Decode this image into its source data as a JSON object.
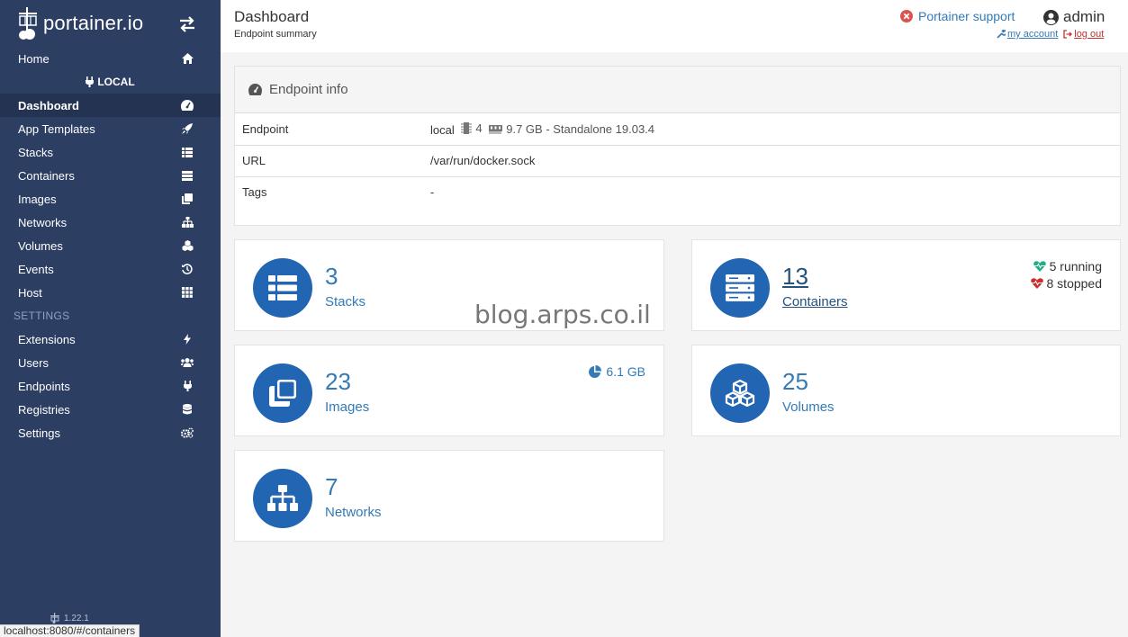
{
  "brand": {
    "name": "portainer.io"
  },
  "sidebar": {
    "items_top": [
      {
        "label": "Home",
        "icon": "home-icon"
      }
    ],
    "endpoint_header": "LOCAL",
    "items": [
      {
        "label": "Dashboard",
        "icon": "dashboard-icon",
        "active": true
      },
      {
        "label": "App Templates",
        "icon": "rocket-icon"
      },
      {
        "label": "Stacks",
        "icon": "list-icon"
      },
      {
        "label": "Containers",
        "icon": "server-icon"
      },
      {
        "label": "Images",
        "icon": "clone-icon"
      },
      {
        "label": "Networks",
        "icon": "sitemap-icon"
      },
      {
        "label": "Volumes",
        "icon": "cubes-icon"
      },
      {
        "label": "Events",
        "icon": "history-icon"
      },
      {
        "label": "Host",
        "icon": "th-icon"
      }
    ],
    "settings_title": "SETTINGS",
    "settings_items": [
      {
        "label": "Extensions",
        "icon": "bolt-icon"
      },
      {
        "label": "Users",
        "icon": "users-icon"
      },
      {
        "label": "Endpoints",
        "icon": "plug-icon"
      },
      {
        "label": "Registries",
        "icon": "database-icon"
      },
      {
        "label": "Settings",
        "icon": "cogs-icon"
      }
    ],
    "version": "1.22.1"
  },
  "status_bar": {
    "url": "localhost:8080/#/containers"
  },
  "header": {
    "title": "Dashboard",
    "subtitle": "Endpoint summary",
    "support_label": "Portainer support",
    "username": "admin",
    "my_account": "my account",
    "logout": "log out"
  },
  "endpoint_info": {
    "title": "Endpoint info",
    "rows": [
      {
        "key": "Endpoint",
        "value": "local",
        "cpus": "4",
        "memory": "9.7 GB - Standalone 19.03.4"
      },
      {
        "key": "URL",
        "value": "/var/run/docker.sock"
      },
      {
        "key": "Tags",
        "value": "-"
      }
    ]
  },
  "tiles": {
    "stacks": {
      "count": "3",
      "label": "Stacks"
    },
    "containers": {
      "count": "13",
      "label": "Containers",
      "running": "5 running",
      "stopped": "8 stopped"
    },
    "images": {
      "count": "23",
      "label": "Images",
      "size": "6.1 GB"
    },
    "volumes": {
      "count": "25",
      "label": "Volumes"
    },
    "networks": {
      "count": "7",
      "label": "Networks"
    }
  },
  "watermark": "blog.arps.co.il",
  "colors": {
    "sidebar": "#2d3e63",
    "accent": "#2165b3",
    "link": "#337ab7",
    "danger": "#c9302c",
    "running": "#23ae89",
    "stopped": "#c9302c"
  }
}
